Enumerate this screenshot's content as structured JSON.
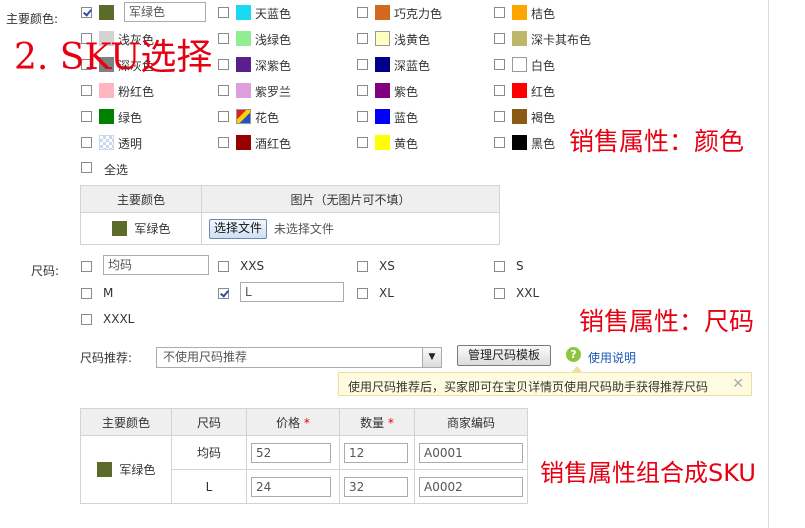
{
  "overlay": {
    "title": "2. SKU选择",
    "color_label": "销售属性：颜色",
    "size_label": "销售属性：尺码",
    "sku_label": "销售属性组合成SKU"
  },
  "color_section": {
    "label": "主要颜色:",
    "custom_value": "军绿色",
    "colors": [
      {
        "name": "",
        "color": "#5b6b2a",
        "checked": true
      },
      {
        "name": "天蓝色",
        "color": "#1ad9f5",
        "checked": false
      },
      {
        "name": "巧克力色",
        "color": "#d2691e",
        "checked": false
      },
      {
        "name": "桔色",
        "color": "#ffa500",
        "checked": false
      },
      {
        "name": "浅灰色",
        "color": "#d3d3d3",
        "checked": false
      },
      {
        "name": "浅绿色",
        "color": "#90ee90",
        "checked": false
      },
      {
        "name": "浅黄色",
        "color": "#ffffc0",
        "checked": false
      },
      {
        "name": "深卡其布色",
        "color": "#bdb76b",
        "checked": false
      },
      {
        "name": "深灰色",
        "color": "#808080",
        "checked": false
      },
      {
        "name": "深紫色",
        "color": "#5a1f8c",
        "checked": false
      },
      {
        "name": "深蓝色",
        "color": "#00008b",
        "checked": false
      },
      {
        "name": "白色",
        "color": "#ffffff",
        "checked": false
      },
      {
        "name": "粉红色",
        "color": "#ffb6c1",
        "checked": false
      },
      {
        "name": "紫罗兰",
        "color": "#dda0dd",
        "checked": false
      },
      {
        "name": "紫色",
        "color": "#800080",
        "checked": false
      },
      {
        "name": "红色",
        "color": "#ff0000",
        "checked": false
      },
      {
        "name": "绿色",
        "color": "#008000",
        "checked": false
      },
      {
        "name": "花色",
        "color": "pattern-floral",
        "checked": false
      },
      {
        "name": "蓝色",
        "color": "#0000ff",
        "checked": false
      },
      {
        "name": "褐色",
        "color": "#8b5a14",
        "checked": false
      },
      {
        "name": "透明",
        "color": "pattern-transparent",
        "checked": false
      },
      {
        "name": "酒红色",
        "color": "#990000",
        "checked": false
      },
      {
        "name": "黄色",
        "color": "#ffff00",
        "checked": false
      },
      {
        "name": "黑色",
        "color": "#000000",
        "checked": false
      }
    ],
    "select_all": "全选"
  },
  "image_table": {
    "headers": [
      "主要颜色",
      "图片（无图片可不填）"
    ],
    "row": {
      "color_name": "军绿色",
      "color": "#5b6b2a",
      "choose_file": "选择文件",
      "no_file": "未选择文件"
    }
  },
  "size_section": {
    "label": "尺码:",
    "sizes": [
      {
        "name": "均码",
        "checked": false,
        "input": true
      },
      {
        "name": "XXS",
        "checked": false
      },
      {
        "name": "XS",
        "checked": false
      },
      {
        "name": "S",
        "checked": false
      },
      {
        "name": "M",
        "checked": false
      },
      {
        "name": "L",
        "checked": true,
        "input": true
      },
      {
        "name": "XL",
        "checked": false
      },
      {
        "name": "XXL",
        "checked": false
      },
      {
        "name": "XXXL",
        "checked": false
      }
    ],
    "recommend_label": "尺码推荐:",
    "recommend_value": "不使用尺码推荐",
    "manage_button": "管理尺码模板",
    "help_link": "使用说明",
    "tip": "使用尺码推荐后，买家即可在宝贝详情页使用尺码助手获得推荐尺码"
  },
  "sku_table": {
    "headers": [
      "主要颜色",
      "尺码",
      "价格",
      "数量",
      "商家编码"
    ],
    "color_name": "军绿色",
    "color": "#5b6b2a",
    "rows": [
      {
        "size": "均码",
        "price": "52",
        "qty": "12",
        "code": "A0001"
      },
      {
        "size": "L",
        "price": "24",
        "qty": "32",
        "code": "A0002"
      }
    ]
  }
}
